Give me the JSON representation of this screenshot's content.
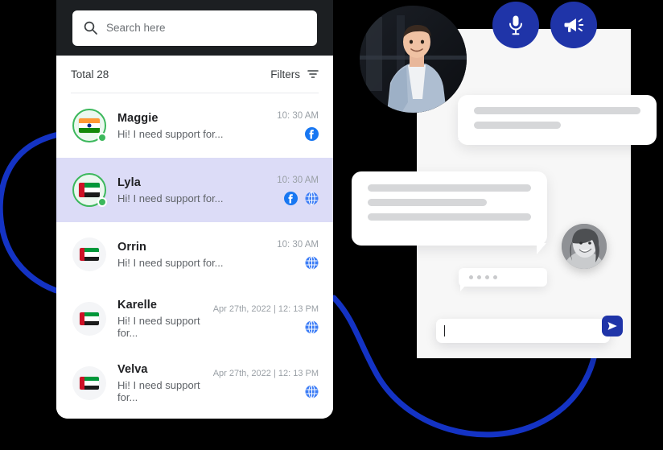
{
  "theme": {
    "brand_blue": "#1f34a8",
    "arc_blue": "#1433c4",
    "header_dark": "#1c1f22",
    "selected_row": "#dcdcf7",
    "online_green": "#3cb85c",
    "channel_blue": "#3b7cf6"
  },
  "search": {
    "placeholder": "Search here",
    "value": "",
    "icon": "search-icon"
  },
  "list_header": {
    "total_label": "Total",
    "total_count": "28",
    "filters_label": "Filters",
    "filters_icon": "filter-icon"
  },
  "conversations": [
    {
      "name": "Maggie",
      "snippet": "Hi! I need support for...",
      "time": "10: 30 AM",
      "flag": "india-flag",
      "online": true,
      "selected": false,
      "channels": [
        "facebook-icon"
      ]
    },
    {
      "name": "Lyla",
      "snippet": "Hi! I need support for...",
      "time": "10: 30 AM",
      "flag": "uae-flag",
      "online": true,
      "selected": true,
      "channels": [
        "facebook-icon",
        "web-globe-icon"
      ]
    },
    {
      "name": "Orrin",
      "snippet": "Hi! I need support for...",
      "time": "10: 30 AM",
      "flag": "uae-flag",
      "online": false,
      "selected": false,
      "channels": [
        "web-globe-icon"
      ]
    },
    {
      "name": "Karelle",
      "snippet": "Hi! I need support for...",
      "time": "Apr 27th, 2022 | 12: 13 PM",
      "flag": "uae-flag",
      "online": false,
      "selected": false,
      "channels": [
        "web-globe-icon"
      ]
    },
    {
      "name": "Velva",
      "snippet": "Hi! I need support for...",
      "time": "Apr 27th, 2022 | 12: 13 PM",
      "flag": "uae-flag",
      "online": false,
      "selected": false,
      "channels": [
        "web-globe-icon"
      ]
    }
  ],
  "chat": {
    "action_buttons": [
      {
        "name": "microphone-button",
        "icon": "microphone-icon"
      },
      {
        "name": "announcement-button",
        "icon": "megaphone-icon"
      }
    ],
    "outgoing_bubble": {
      "placeholder_lines": [
        100,
        52
      ]
    },
    "incoming_bubble": {
      "placeholder_lines": [
        100,
        73,
        100
      ]
    },
    "typing_indicator": {
      "dots": 4
    },
    "composer": {
      "value": "",
      "placeholder": "",
      "send_icon": "send-icon"
    },
    "avatars": {
      "agent": "agent-photo-avatar",
      "customer": "customer-photo-avatar"
    }
  }
}
